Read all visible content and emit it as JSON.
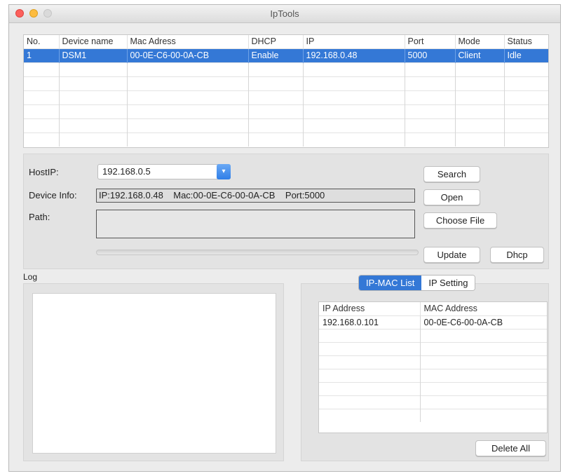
{
  "window": {
    "title": "IpTools"
  },
  "device_table": {
    "columns": [
      "No.",
      "Device name",
      "Mac Adress",
      "DHCP",
      "IP",
      "Port",
      "Mode",
      "Status"
    ],
    "rows": [
      [
        "1",
        "DSM1",
        "00-0E-C6-00-0A-CB",
        "Enable",
        "192.168.0.48",
        "5000",
        "Client",
        "Idle"
      ]
    ]
  },
  "host": {
    "host_ip_label": "HostIP:",
    "host_ip_value": "192.168.0.5",
    "device_info_label": "Device Info:",
    "device_info_value": "IP:192.168.0.48    Mac:00-0E-C6-00-0A-CB    Port:5000",
    "path_label": "Path:",
    "path_value": "",
    "buttons": {
      "search": "Search",
      "open": "Open",
      "choose_file": "Choose File",
      "update": "Update",
      "dhcp": "Dhcp"
    }
  },
  "log": {
    "label": "Log",
    "content": ""
  },
  "ipmac": {
    "tabs": [
      "IP-MAC List",
      "IP Setting"
    ],
    "active_tab": "IP-MAC List",
    "columns": [
      "IP Address",
      "MAC Address"
    ],
    "rows": [
      [
        "192.168.0.101",
        "00-0E-C6-00-0A-CB"
      ]
    ],
    "delete_all": "Delete All"
  },
  "colors": {
    "selection": "#3478d6",
    "close": "#fc605c",
    "minimize": "#fdbc40"
  }
}
